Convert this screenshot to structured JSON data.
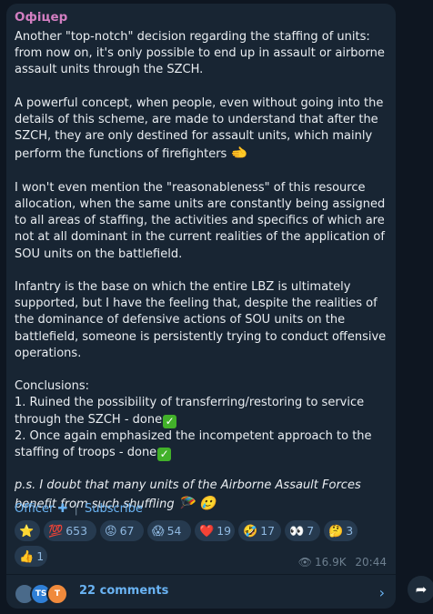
{
  "post": {
    "author": "Офіцер",
    "paragraphs": [
      "Another \"top-notch\" decision regarding the staffing of units: from now on, it's only possible to end up in assault or airborne assault units through the SZCH.",
      "A powerful concept, when people, even without going into the details of this scheme, are made to understand that after the SZCH, they are only destined for assault units, which mainly perform the functions of firefighters",
      "I won't even mention the \"reasonableness\" of this resource allocation, when the same units are constantly being assigned to all areas of staffing, the activities and specifics of which are not at all dominant in the current realities of the application of SOU units on the battlefield.",
      "Infantry is the base on which the entire LBZ is ultimately supported, but I have the feeling that, despite the realities of the dominance of defensive actions of SOU units on the battlefield, someone is persistently trying to conduct offensive operations."
    ],
    "conclusions_title": "Conclusions:",
    "conclusion_1": "1. Ruined the possibility of transferring/restoring to service through the SZCH - done",
    "conclusion_2": "2. Once again emphasized the incompetent approach to the staffing of troops - done",
    "ps": "p.s. I doubt that many units of the Airborne Assault Forces benefit from such shuffling",
    "emojis": {
      "firefighters": "🫲",
      "check": "✓",
      "ps_1": "🪂",
      "ps_2": "🥲"
    }
  },
  "signature": {
    "channel": "Officer",
    "plus": "✚",
    "separator": "|",
    "subscribe": "Subscribe"
  },
  "reactions": [
    {
      "emoji": "⭐",
      "count": ""
    },
    {
      "emoji": "💯",
      "count": "653"
    },
    {
      "emoji": "😡",
      "count": "67"
    },
    {
      "emoji": "😱",
      "count": "54"
    },
    {
      "emoji": "❤️",
      "count": "19"
    },
    {
      "emoji": "🤣",
      "count": "17"
    },
    {
      "emoji": "👀",
      "count": "7"
    },
    {
      "emoji": "🤔",
      "count": "3"
    },
    {
      "emoji": "👍",
      "count": "1"
    }
  ],
  "meta": {
    "views": "16.9K",
    "time": "20:44",
    "eye_icon": "eye-icon"
  },
  "comments": {
    "avatars": [
      "",
      "TS",
      "T"
    ],
    "avatar_colors": [
      "#4a6a8a",
      "#2f7fd6",
      "#f08a3c"
    ],
    "label": "22 comments",
    "chevron": "›"
  },
  "share_icon": "➦"
}
